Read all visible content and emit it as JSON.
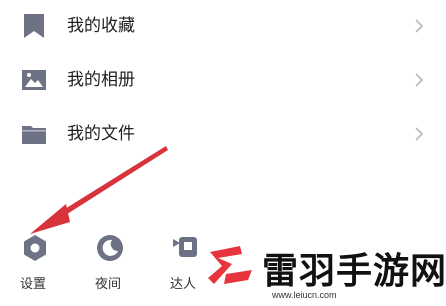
{
  "menu": {
    "items": [
      {
        "label": "我的收藏",
        "icon": "bookmark-icon"
      },
      {
        "label": "我的相册",
        "icon": "image-icon"
      },
      {
        "label": "我的文件",
        "icon": "folder-icon"
      }
    ]
  },
  "bottom_bar": {
    "items": [
      {
        "label": "设置",
        "icon": "settings-icon"
      },
      {
        "label": "夜间",
        "icon": "moon-icon"
      },
      {
        "label": "达人",
        "icon": "expert-icon"
      }
    ]
  },
  "watermark": {
    "text": "雷羽手游网",
    "url": "www.leiucn.com"
  },
  "colors": {
    "icon": "#6d7385",
    "arrow": "#d8323a",
    "chevron": "#b9bcc2",
    "watermark_red": "#e8343d"
  }
}
